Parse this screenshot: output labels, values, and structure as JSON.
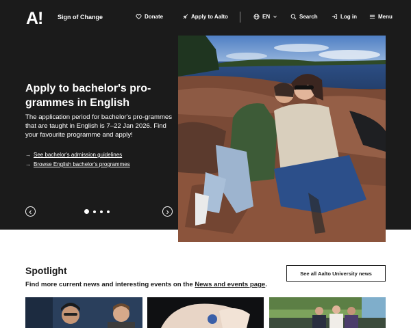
{
  "header": {
    "logo": "A!",
    "tagline": "Sign of Change",
    "nav": {
      "donate": "Donate",
      "apply": "Apply to Aalto",
      "language": "EN",
      "search": "Search",
      "login": "Log in",
      "menu": "Menu"
    }
  },
  "hero": {
    "title": "Apply to bachelor's pro-grammes in English",
    "description": "The application period for bachelor's pro-grammes that are taught in English is 7–22 Jan 2026. Find your favourite programme and apply!",
    "links": [
      "See bachelor's admission guidelines",
      "Browse English bachelor's programmes"
    ],
    "carousel": {
      "slides": 4,
      "active": 1
    }
  },
  "spotlight": {
    "title": "Spotlight",
    "description_prefix": "Find more current news and interesting events on the ",
    "description_link": "News and events page",
    "description_suffix": ".",
    "see_all_button": "See all Aalto University news"
  },
  "icons": {
    "donate": "heart-icon",
    "apply": "rocket-icon",
    "language": "globe-icon",
    "search": "search-icon",
    "login": "login-icon",
    "menu": "hamburger-icon"
  },
  "colors": {
    "background_dark": "#1b1b1b",
    "text_light": "#ffffff",
    "text_dark": "#1b1b1b"
  }
}
